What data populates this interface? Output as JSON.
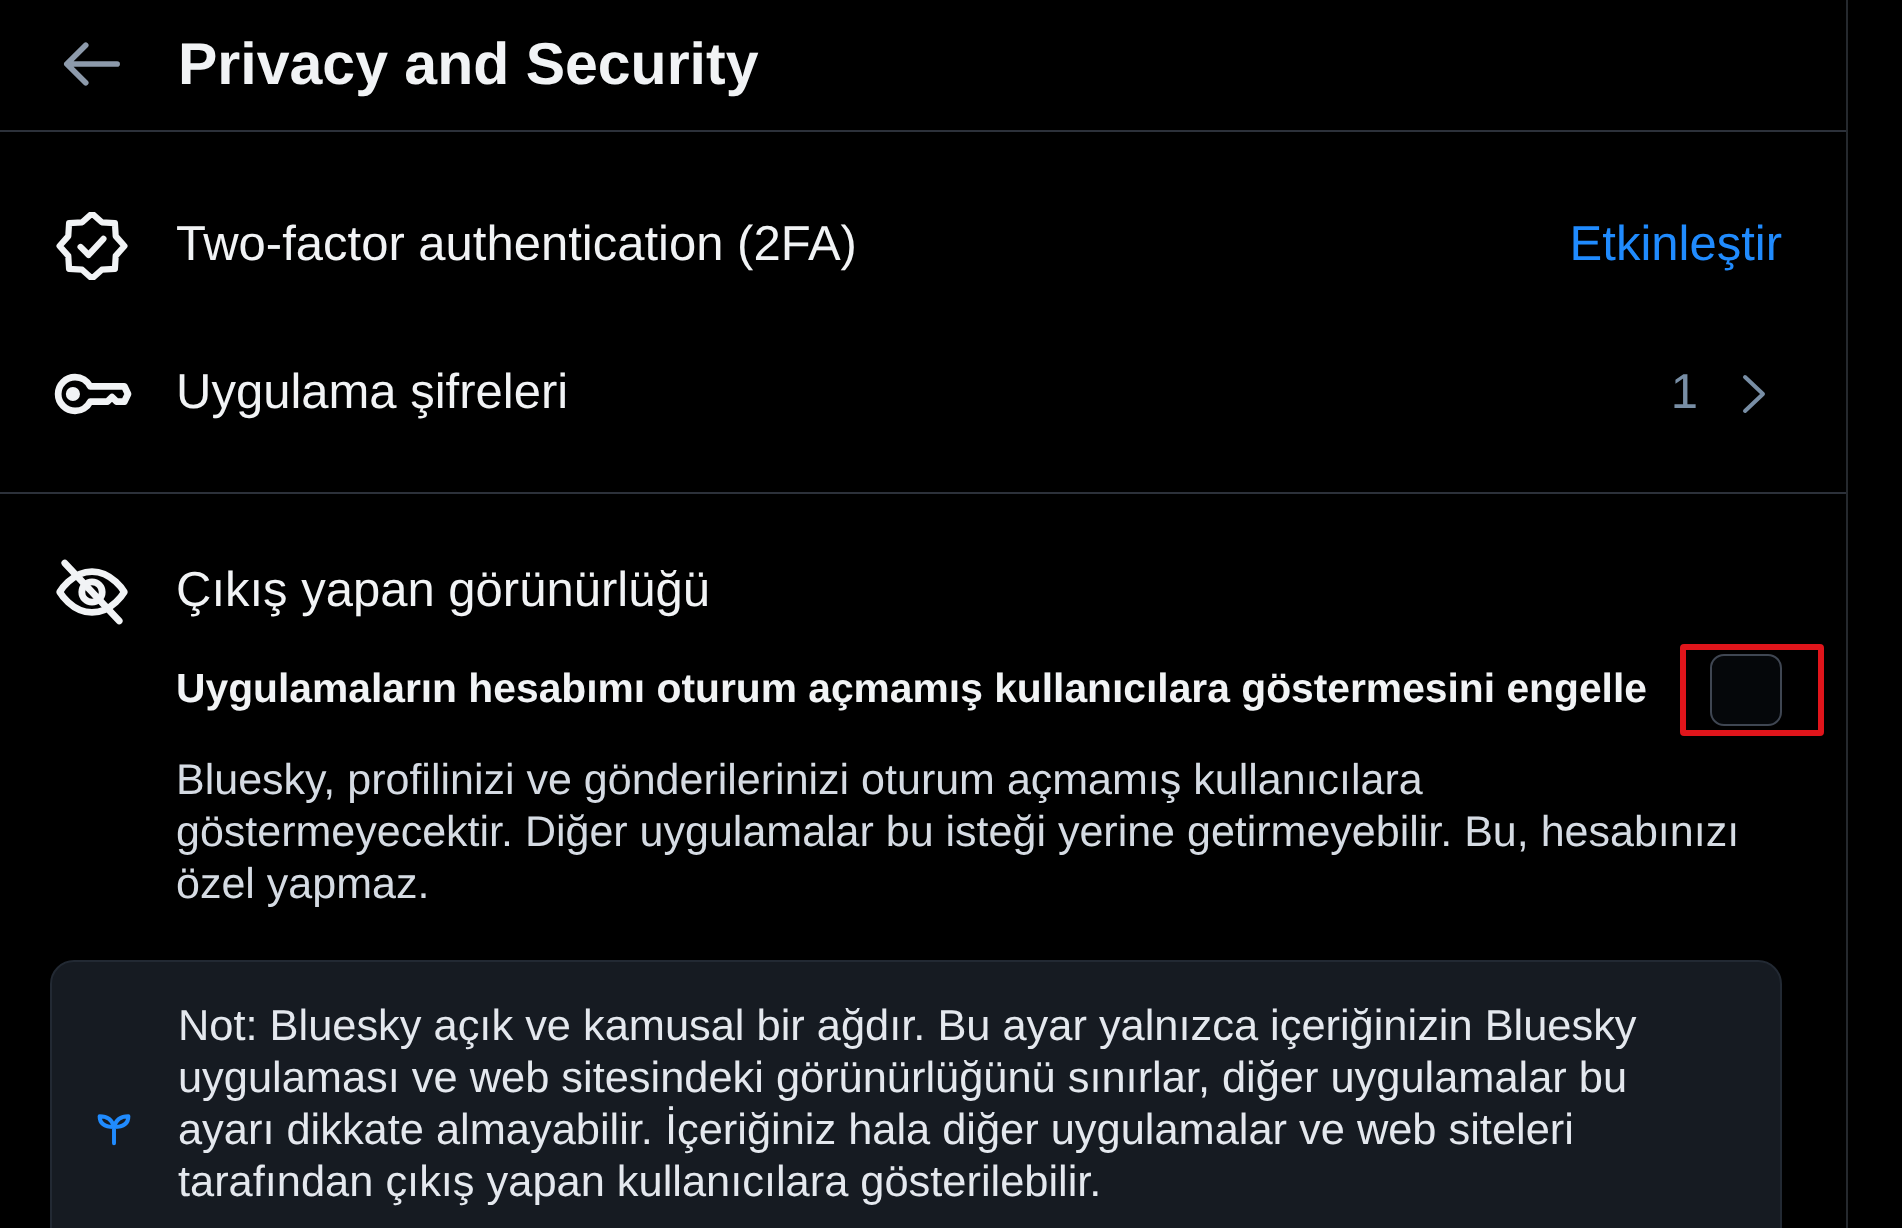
{
  "header": {
    "title": "Privacy and Security"
  },
  "security_items": [
    {
      "kind": "action",
      "label": "Two-factor authentication (2FA)",
      "action": "Etkinleştir"
    },
    {
      "kind": "link",
      "label": "Uygulama şifreleri",
      "count": "1"
    }
  ],
  "visibility": {
    "title": "Çıkış yapan görünürlüğü",
    "setting": {
      "label": "Uygulamaların hesabımı oturum açmamış kullanıcılara göstermesini engelle",
      "checked": false,
      "highlighted": true
    },
    "description": "Bluesky, profilinizi ve gönderilerinizi oturum açmamış kullanıcılara\ngöstermeyecektir. Diğer uygulamalar bu isteği yerine getirmeyebilir. Bu, hesabınızı özel yapmaz.",
    "note": "Not: Bluesky açık ve kamusal bir ağdır. Bu ayar yalnızca içeriğinizin Bluesky uygulaması ve web sitesindeki görünürlüğünü sınırlar, diğer uygulamalar bu ayarı dikkate almayabilir. İçeriğiniz hala diğer uygulamalar ve web siteleri tarafından çıkış yapan kullanıcılara gösterilebilir."
  }
}
